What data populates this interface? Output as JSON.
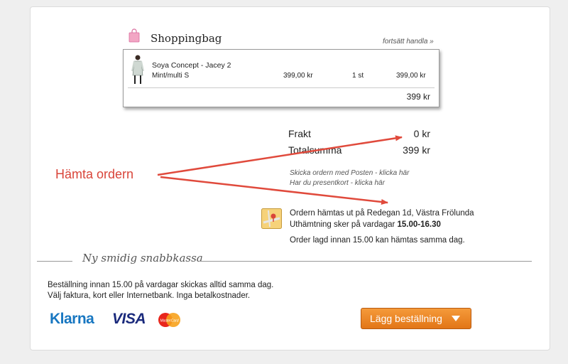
{
  "cart": {
    "title": "Shoppingbag",
    "continue_label": "fortsätt handla »",
    "items": [
      {
        "name": "Soya Concept - Jacey 2",
        "variant": "Mint/multi S",
        "price": "399,00 kr",
        "qty": "1 st",
        "total": "399,00 kr"
      }
    ],
    "subtotal": "399 kr"
  },
  "totals": {
    "shipping_label": "Frakt",
    "shipping_value": "0 kr",
    "total_label": "Totalsumma",
    "total_value": "399 kr"
  },
  "links": {
    "post": "Skicka ordern med Posten - klicka här",
    "giftcard": "Har du presentkort - klicka här"
  },
  "annotation": {
    "text": "Hämta ordern",
    "color": "#d9453a"
  },
  "pickup": {
    "line1": "Ordern hämtas ut på Redegan 1d, Västra Frölunda",
    "line2_prefix": "Uthämtning sker på vardagar ",
    "line2_hours": "15.00-16.30",
    "line3": "Order lagd innan 15.00 kan hämtas samma dag."
  },
  "checkout": {
    "section_title": "Ny smidig snabbkassa",
    "info_line1": "Beställning innan 15.00 på vardagar skickas alltid samma dag.",
    "info_line2": "Välj faktura, kort eller Internetbank. Inga betalkostnader.",
    "payment_logos": {
      "klarna": "Klarna",
      "visa": "VISA",
      "mastercard": "MasterCard"
    },
    "order_button": "Lägg beställning"
  },
  "colors": {
    "accent_orange": "#e8801f",
    "klarna_blue": "#1877c1",
    "visa_navy": "#1a2a7c"
  }
}
